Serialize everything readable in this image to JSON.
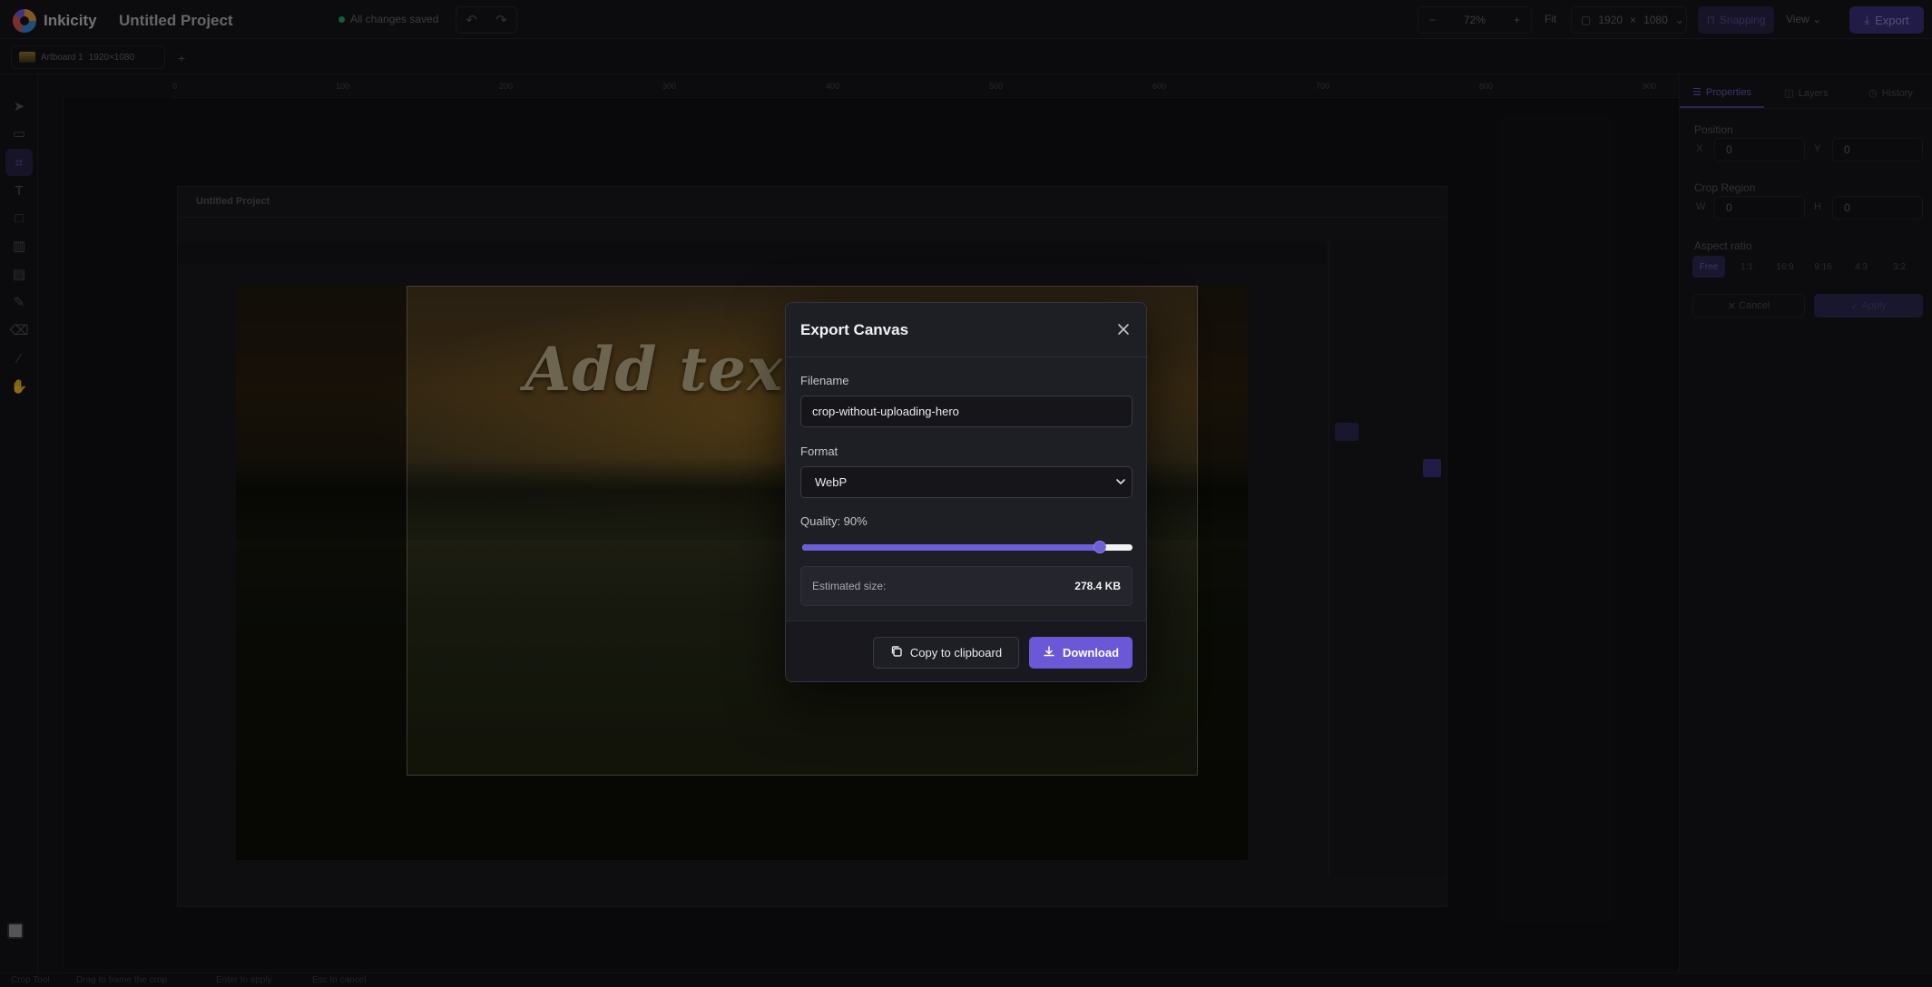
{
  "app": {
    "name": "Inkicity",
    "project": "Untitled Project",
    "save_status": "All changes saved"
  },
  "topbar": {
    "zoom": "72%",
    "fit_label": "Fit",
    "width": "1920",
    "height": "1080",
    "snapping_label": "Snapping",
    "view_label": "View",
    "export_label": "Export"
  },
  "artboard_tab": {
    "name": "Artboard 1",
    "size": "1920×1080"
  },
  "ruler_ticks": [
    "0",
    "100",
    "200",
    "300",
    "400",
    "500",
    "600",
    "700",
    "800",
    "900"
  ],
  "right_panel": {
    "tabs": [
      {
        "label": "Properties",
        "icon": "sliders-icon"
      },
      {
        "label": "Layers",
        "icon": "layers-icon"
      },
      {
        "label": "History",
        "icon": "history-icon"
      }
    ],
    "position_label": "Position",
    "x_prefix": "X",
    "x_value": "0",
    "y_prefix": "Y",
    "y_value": "0",
    "crop_label": "Crop Region",
    "w_prefix": "W",
    "w_value": "0",
    "h_prefix": "H",
    "h_value": "0",
    "aspect_label": "Aspect ratio",
    "ratios": [
      "Free",
      "1:1",
      "16:9",
      "9:16",
      "4:3",
      "3:2"
    ],
    "cancel_label": "Cancel",
    "apply_label": "Apply"
  },
  "canvas": {
    "overlay_text": "Add text to"
  },
  "nested": {
    "title": "Untitled Project"
  },
  "statusbar": {
    "tool": "Crop Tool",
    "hint1": "Drag to frame the crop",
    "hint2": "Enter to apply",
    "hint3": "Esc to cancel"
  },
  "dialog": {
    "title": "Export Canvas",
    "filename_label": "Filename",
    "filename_value": "crop-without-uploading-hero",
    "format_label": "Format",
    "format_value": "WebP",
    "quality_label": "Quality: 90%",
    "quality_value": 0.9,
    "estimated_label": "Estimated size:",
    "estimated_value": "278.4 KB",
    "copy_label": "Copy to clipboard",
    "download_label": "Download"
  },
  "colors": {
    "accent": "#6a58d6",
    "background": "#15151b",
    "dialog": "#1e1e25"
  }
}
